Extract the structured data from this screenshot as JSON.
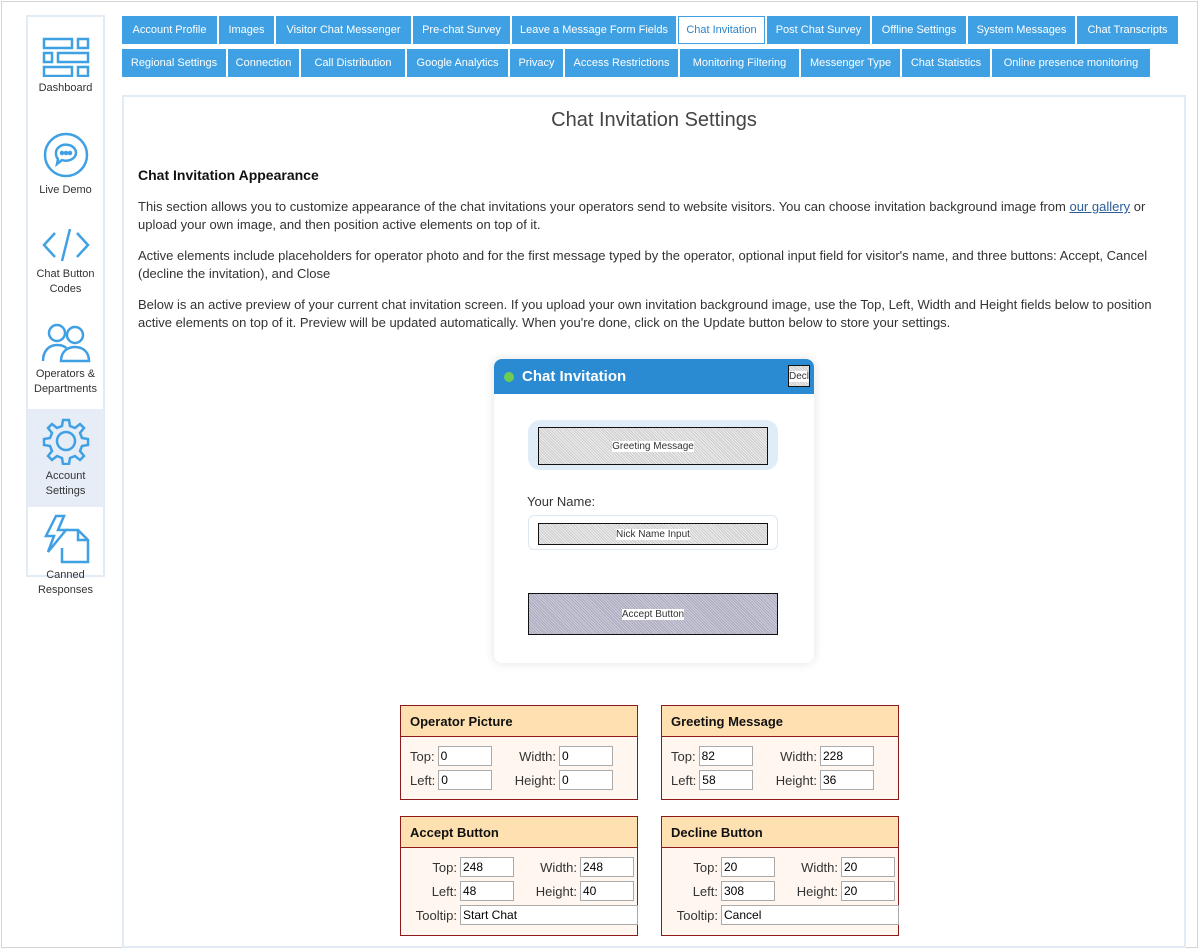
{
  "sidebar": {
    "items": [
      {
        "label": "Dashboard",
        "icon": "dashboard-icon"
      },
      {
        "label": "Live Demo",
        "icon": "chat-bubble-icon"
      },
      {
        "label": "Chat Button Codes",
        "icon": "code-icon"
      },
      {
        "label": "Operators & Departments",
        "icon": "users-icon"
      },
      {
        "label": "Account Settings",
        "icon": "gear-icon",
        "active": true
      },
      {
        "label": "Canned Responses",
        "icon": "document-lightning-icon"
      }
    ]
  },
  "tabs_row1": [
    "Account Profile",
    "Images",
    "Visitor Chat Messenger",
    "Pre-chat Survey",
    "Leave a Message Form Fields",
    "Chat Invitation",
    "Post Chat Survey",
    "Offline Settings",
    "System Messages",
    "Chat Transcripts"
  ],
  "tabs_row2": [
    "Regional Settings",
    "Connection",
    "Call Distribution",
    "Google Analytics",
    "Privacy",
    "Access Restrictions",
    "Monitoring Filtering",
    "Messenger Type",
    "Chat Statistics",
    "Online presence monitoring"
  ],
  "active_tab": "Chat Invitation",
  "page": {
    "title": "Chat Invitation Settings",
    "section_title": "Chat Invitation Appearance",
    "p1_a": "This section allows you to customize appearance of the chat invitations your operators send to website visitors. You can choose invitation background image from ",
    "p1_link": "our gallery",
    "p1_b": " or upload your own image, and then position active elements on top of it.",
    "p2": "Active elements include placeholders for operator photo and for the first message typed by the operator, optional input field for visitor's name, and three buttons: Accept, Cancel (decline the invitation), and Close",
    "p3": "Below is an active preview of your current chat invitation screen. If you upload your own invitation background image, use the Top, Left, Width and Height fields below to position active elements on top of it. Preview will be updated automatically. When you're done, click on the Update button below to store your settings."
  },
  "preview": {
    "header": "Chat Invitation",
    "decline": "Decl",
    "greeting": "Greeting Message",
    "name_label": "Your Name:",
    "nick": "Nick Name Input",
    "accept": "Accept Button",
    "header_color": "#2a8bd2",
    "status_color": "#6ccd52"
  },
  "boxes": {
    "operator": {
      "title": "Operator Picture",
      "top": "0",
      "left": "0",
      "width": "0",
      "height": "0"
    },
    "greeting": {
      "title": "Greeting Message",
      "top": "82",
      "left": "58",
      "width": "228",
      "height": "36"
    },
    "accept": {
      "title": "Accept Button",
      "top": "248",
      "left": "48",
      "width": "248",
      "height": "40",
      "tooltip": "Start Chat"
    },
    "decline": {
      "title": "Decline Button",
      "top": "20",
      "left": "308",
      "width": "20",
      "height": "20",
      "tooltip": "Cancel"
    }
  },
  "labels": {
    "top": "Top:",
    "left": "Left:",
    "width": "Width:",
    "height": "Height:",
    "tooltip": "Tooltip:"
  }
}
